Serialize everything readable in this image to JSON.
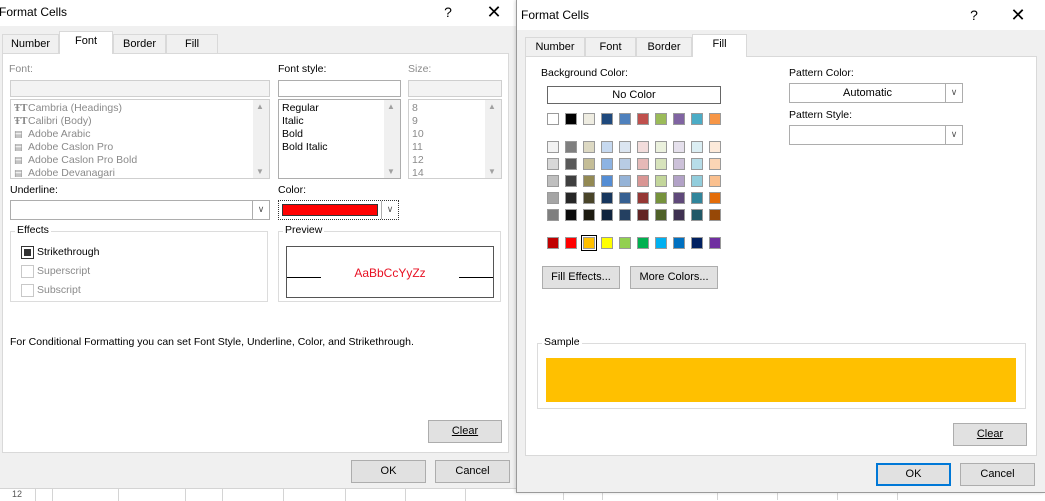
{
  "colors": {
    "dialog_bg": "#f0f0f0",
    "accent": "#0078d7",
    "font_color": "#ff0000",
    "preview_text": "#e81123",
    "sample_fill": "#ffc000"
  },
  "left_dialog": {
    "title": "Format Cells",
    "help": "?",
    "close": "✕",
    "tabs": [
      "Number",
      "Font",
      "Border",
      "Fill"
    ],
    "active_tab": "Font",
    "font_label": "Font:",
    "font_input_value": "",
    "font_list": [
      "Cambria (Headings)",
      "Calibri (Body)",
      "Adobe Arabic",
      "Adobe Caslon Pro",
      "Adobe Caslon Pro Bold",
      "Adobe Devanagari"
    ],
    "font_icon": "truetype-icon",
    "style_label": "Font style:",
    "style_input_value": "",
    "style_list": [
      "Regular",
      "Italic",
      "Bold",
      "Bold Italic"
    ],
    "size_label": "Size:",
    "size_input_value": "",
    "size_list": [
      "8",
      "9",
      "10",
      "11",
      "12",
      "14"
    ],
    "underline_label": "Underline:",
    "underline_value": "",
    "color_label": "Color:",
    "color_value": "#ff0000",
    "effects_title": "Effects",
    "effects": [
      {
        "label": "Strikethrough",
        "checked": true,
        "enabled": true
      },
      {
        "label": "Superscript",
        "checked": false,
        "enabled": false
      },
      {
        "label": "Subscript",
        "checked": false,
        "enabled": false
      }
    ],
    "preview_title": "Preview",
    "preview_text": "AaBbCcYyZz",
    "info_text": "For Conditional Formatting you can set Font Style, Underline, Color, and Strikethrough.",
    "clear_label": "Clear",
    "ok_label": "OK",
    "cancel_label": "Cancel"
  },
  "right_dialog": {
    "title": "Format Cells",
    "help": "?",
    "close": "✕",
    "tabs": [
      "Number",
      "Font",
      "Border",
      "Fill"
    ],
    "active_tab": "Fill",
    "bg_color_label": "Background Color:",
    "no_color_label": "No Color",
    "theme_top_row": [
      "#ffffff",
      "#000000",
      "#eeece1",
      "#1f497d",
      "#4f81bd",
      "#c0504d",
      "#9bbb59",
      "#8064a2",
      "#4bacc6",
      "#f79646"
    ],
    "theme_shades": [
      [
        "#f2f2f2",
        "#7f7f7f",
        "#ddd9c3",
        "#c6d9f0",
        "#dbe5f1",
        "#f2dcdb",
        "#ebf1dd",
        "#e5e0ec",
        "#dbeef3",
        "#fdeada"
      ],
      [
        "#d8d8d8",
        "#595959",
        "#c4bd97",
        "#8db3e2",
        "#b8cce4",
        "#e5b9b7",
        "#d7e3bc",
        "#ccc1d9",
        "#b7dde8",
        "#fbd5b5"
      ],
      [
        "#bfbfbf",
        "#3f3f3f",
        "#938953",
        "#548dd4",
        "#95b3d7",
        "#d99694",
        "#c3d69b",
        "#b2a2c7",
        "#92cddc",
        "#fac08f"
      ],
      [
        "#a5a5a5",
        "#262626",
        "#494429",
        "#17365d",
        "#366092",
        "#953734",
        "#76923c",
        "#5f497a",
        "#31859b",
        "#e36c09"
      ],
      [
        "#7f7f7f",
        "#0c0c0c",
        "#1d1b10",
        "#0f243e",
        "#244061",
        "#632423",
        "#4f6128",
        "#3f3151",
        "#205867",
        "#974806"
      ]
    ],
    "standard_colors": [
      "#c00000",
      "#ff0000",
      "#ffc000",
      "#ffff00",
      "#92d050",
      "#00b050",
      "#00b0f0",
      "#0070c0",
      "#002060",
      "#7030a0"
    ],
    "selected_standard_index": 2,
    "fill_effects_label": "Fill Effects...",
    "more_colors_label": "More Colors...",
    "pattern_color_label": "Pattern Color:",
    "pattern_color_value": "Automatic",
    "pattern_style_label": "Pattern Style:",
    "pattern_style_value": "",
    "sample_title": "Sample",
    "sample_color": "#ffc000",
    "clear_label": "Clear",
    "ok_label": "OK",
    "cancel_label": "Cancel"
  },
  "sheet": {
    "row_number": "12"
  }
}
